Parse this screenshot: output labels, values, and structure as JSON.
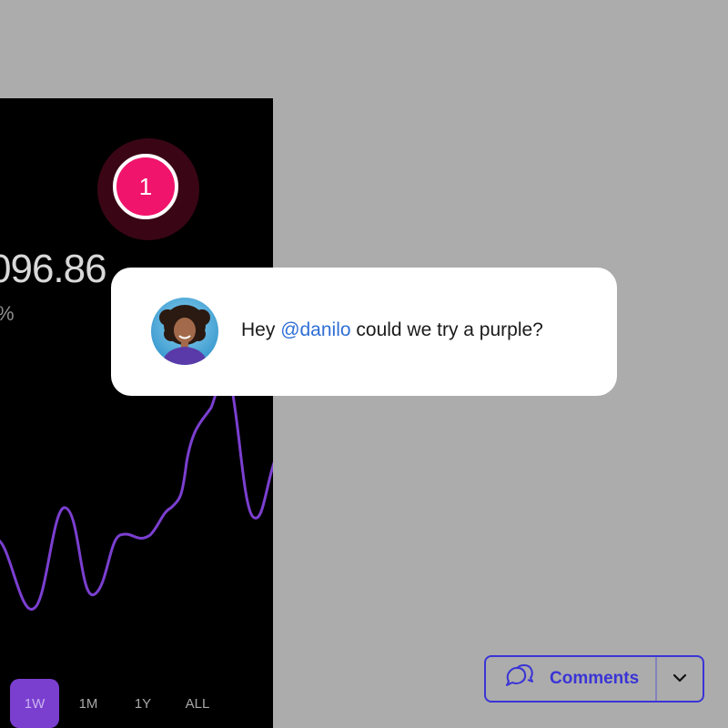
{
  "panel": {
    "price_value": "096.86",
    "price_change": "%",
    "line_color": "#7b3fd0",
    "range_tabs": [
      {
        "label": "1W",
        "active": true
      },
      {
        "label": "1M",
        "active": false
      },
      {
        "label": "1Y",
        "active": false
      },
      {
        "label": "ALL",
        "active": false
      }
    ]
  },
  "badge": {
    "count": "1",
    "color": "#f0146c"
  },
  "comment": {
    "prefix": "Hey ",
    "mention": "@danilo",
    "suffix": " could we try a purple?",
    "avatar_icon": "user-avatar-photo"
  },
  "comments_button": {
    "label": "Comments",
    "icon": "speech-bubbles-icon",
    "toggle_icon": "chevron-down-icon",
    "color": "#3a34d6"
  }
}
